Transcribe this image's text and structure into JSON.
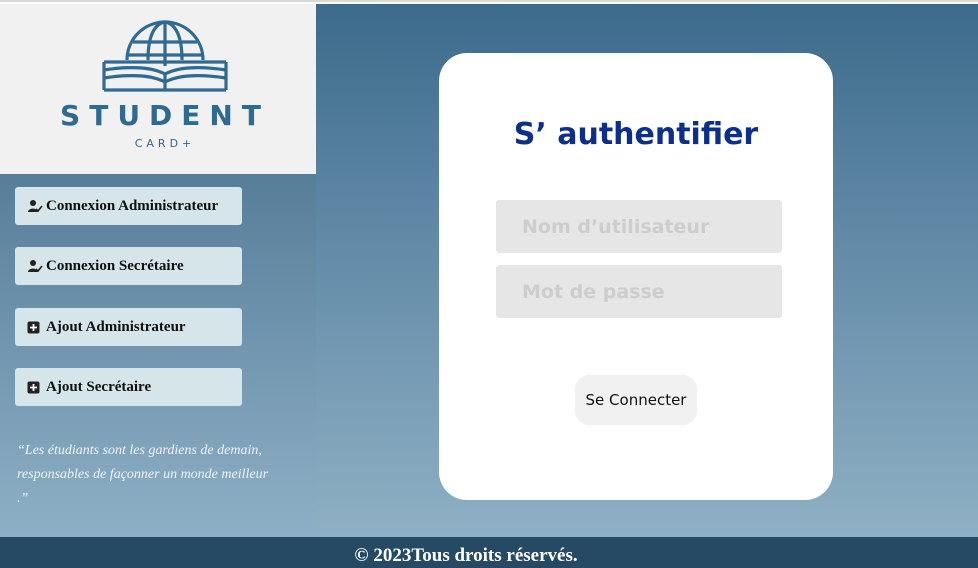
{
  "brand": {
    "title": "STUDENT",
    "subtitle": "CARD+",
    "logo_icon": "globe-book-icon",
    "color": "#2e6a92"
  },
  "sidebar": {
    "items": [
      {
        "label": "Connexion Administrateur",
        "icon": "user-check-icon"
      },
      {
        "label": "Connexion Secrétaire",
        "icon": "user-check-icon"
      },
      {
        "label": "Ajout Administrateur",
        "icon": "plus-square-icon"
      },
      {
        "label": "Ajout Secrétaire",
        "icon": "plus-square-icon"
      }
    ],
    "quote": "“Les étudiants sont les gardiens de demain, responsables de façonner un monde meilleur .”"
  },
  "login": {
    "title": "S’ authentifier",
    "username_placeholder": "Nom d’utilisateur",
    "username_value": "",
    "password_placeholder": "Mot de passe",
    "password_value": "",
    "submit_label": "Se Connecter",
    "title_color": "#0b2f8a"
  },
  "footer": {
    "text": "© 2023Tous droits réservés."
  }
}
